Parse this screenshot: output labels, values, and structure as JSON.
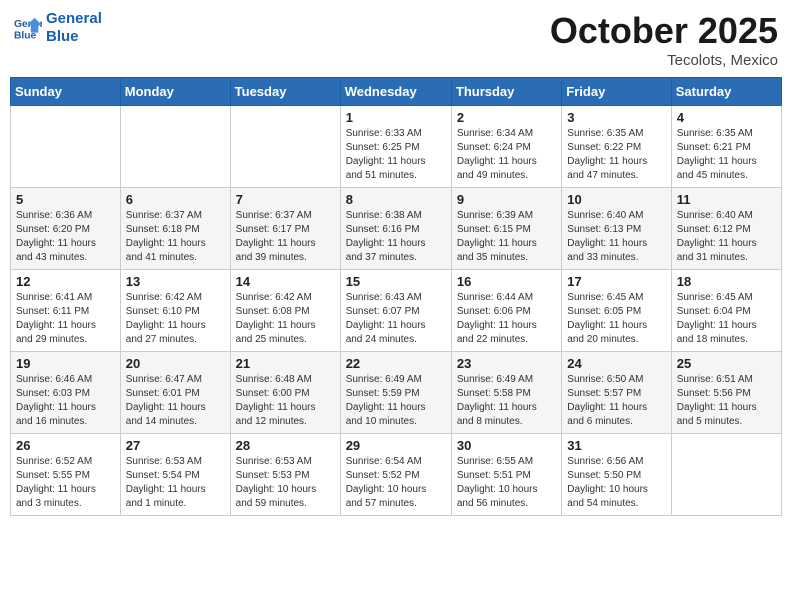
{
  "logo": {
    "line1": "General",
    "line2": "Blue"
  },
  "title": "October 2025",
  "subtitle": "Tecolots, Mexico",
  "days_header": [
    "Sunday",
    "Monday",
    "Tuesday",
    "Wednesday",
    "Thursday",
    "Friday",
    "Saturday"
  ],
  "weeks": [
    [
      {
        "day": "",
        "info": ""
      },
      {
        "day": "",
        "info": ""
      },
      {
        "day": "",
        "info": ""
      },
      {
        "day": "1",
        "info": "Sunrise: 6:33 AM\nSunset: 6:25 PM\nDaylight: 11 hours\nand 51 minutes."
      },
      {
        "day": "2",
        "info": "Sunrise: 6:34 AM\nSunset: 6:24 PM\nDaylight: 11 hours\nand 49 minutes."
      },
      {
        "day": "3",
        "info": "Sunrise: 6:35 AM\nSunset: 6:22 PM\nDaylight: 11 hours\nand 47 minutes."
      },
      {
        "day": "4",
        "info": "Sunrise: 6:35 AM\nSunset: 6:21 PM\nDaylight: 11 hours\nand 45 minutes."
      }
    ],
    [
      {
        "day": "5",
        "info": "Sunrise: 6:36 AM\nSunset: 6:20 PM\nDaylight: 11 hours\nand 43 minutes."
      },
      {
        "day": "6",
        "info": "Sunrise: 6:37 AM\nSunset: 6:18 PM\nDaylight: 11 hours\nand 41 minutes."
      },
      {
        "day": "7",
        "info": "Sunrise: 6:37 AM\nSunset: 6:17 PM\nDaylight: 11 hours\nand 39 minutes."
      },
      {
        "day": "8",
        "info": "Sunrise: 6:38 AM\nSunset: 6:16 PM\nDaylight: 11 hours\nand 37 minutes."
      },
      {
        "day": "9",
        "info": "Sunrise: 6:39 AM\nSunset: 6:15 PM\nDaylight: 11 hours\nand 35 minutes."
      },
      {
        "day": "10",
        "info": "Sunrise: 6:40 AM\nSunset: 6:13 PM\nDaylight: 11 hours\nand 33 minutes."
      },
      {
        "day": "11",
        "info": "Sunrise: 6:40 AM\nSunset: 6:12 PM\nDaylight: 11 hours\nand 31 minutes."
      }
    ],
    [
      {
        "day": "12",
        "info": "Sunrise: 6:41 AM\nSunset: 6:11 PM\nDaylight: 11 hours\nand 29 minutes."
      },
      {
        "day": "13",
        "info": "Sunrise: 6:42 AM\nSunset: 6:10 PM\nDaylight: 11 hours\nand 27 minutes."
      },
      {
        "day": "14",
        "info": "Sunrise: 6:42 AM\nSunset: 6:08 PM\nDaylight: 11 hours\nand 25 minutes."
      },
      {
        "day": "15",
        "info": "Sunrise: 6:43 AM\nSunset: 6:07 PM\nDaylight: 11 hours\nand 24 minutes."
      },
      {
        "day": "16",
        "info": "Sunrise: 6:44 AM\nSunset: 6:06 PM\nDaylight: 11 hours\nand 22 minutes."
      },
      {
        "day": "17",
        "info": "Sunrise: 6:45 AM\nSunset: 6:05 PM\nDaylight: 11 hours\nand 20 minutes."
      },
      {
        "day": "18",
        "info": "Sunrise: 6:45 AM\nSunset: 6:04 PM\nDaylight: 11 hours\nand 18 minutes."
      }
    ],
    [
      {
        "day": "19",
        "info": "Sunrise: 6:46 AM\nSunset: 6:03 PM\nDaylight: 11 hours\nand 16 minutes."
      },
      {
        "day": "20",
        "info": "Sunrise: 6:47 AM\nSunset: 6:01 PM\nDaylight: 11 hours\nand 14 minutes."
      },
      {
        "day": "21",
        "info": "Sunrise: 6:48 AM\nSunset: 6:00 PM\nDaylight: 11 hours\nand 12 minutes."
      },
      {
        "day": "22",
        "info": "Sunrise: 6:49 AM\nSunset: 5:59 PM\nDaylight: 11 hours\nand 10 minutes."
      },
      {
        "day": "23",
        "info": "Sunrise: 6:49 AM\nSunset: 5:58 PM\nDaylight: 11 hours\nand 8 minutes."
      },
      {
        "day": "24",
        "info": "Sunrise: 6:50 AM\nSunset: 5:57 PM\nDaylight: 11 hours\nand 6 minutes."
      },
      {
        "day": "25",
        "info": "Sunrise: 6:51 AM\nSunset: 5:56 PM\nDaylight: 11 hours\nand 5 minutes."
      }
    ],
    [
      {
        "day": "26",
        "info": "Sunrise: 6:52 AM\nSunset: 5:55 PM\nDaylight: 11 hours\nand 3 minutes."
      },
      {
        "day": "27",
        "info": "Sunrise: 6:53 AM\nSunset: 5:54 PM\nDaylight: 11 hours\nand 1 minute."
      },
      {
        "day": "28",
        "info": "Sunrise: 6:53 AM\nSunset: 5:53 PM\nDaylight: 10 hours\nand 59 minutes."
      },
      {
        "day": "29",
        "info": "Sunrise: 6:54 AM\nSunset: 5:52 PM\nDaylight: 10 hours\nand 57 minutes."
      },
      {
        "day": "30",
        "info": "Sunrise: 6:55 AM\nSunset: 5:51 PM\nDaylight: 10 hours\nand 56 minutes."
      },
      {
        "day": "31",
        "info": "Sunrise: 6:56 AM\nSunset: 5:50 PM\nDaylight: 10 hours\nand 54 minutes."
      },
      {
        "day": "",
        "info": ""
      }
    ]
  ]
}
